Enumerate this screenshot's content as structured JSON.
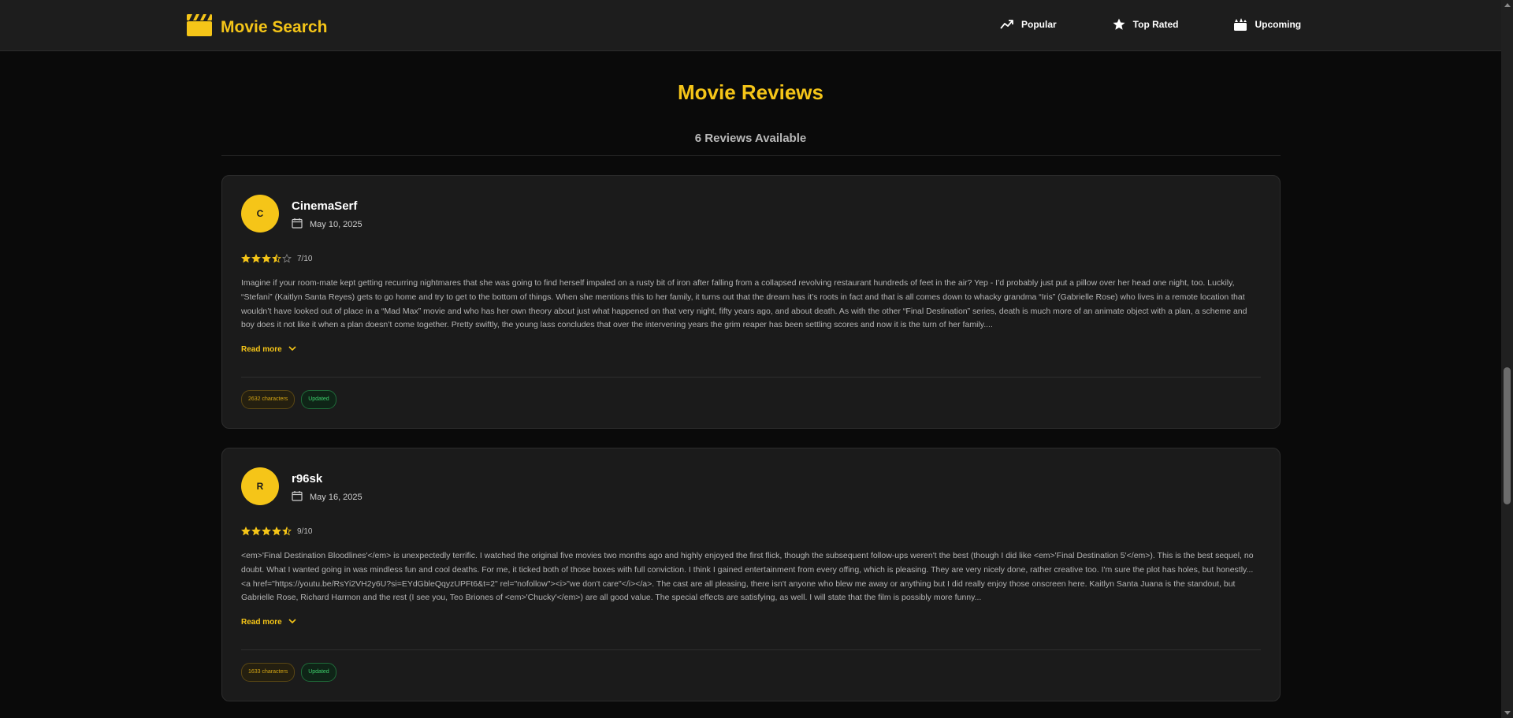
{
  "brand": {
    "title": "Movie Search",
    "icon": "clapperboard-icon",
    "color": "#f5c518"
  },
  "nav": {
    "popular": {
      "label": "Popular",
      "icon": "trending-up-icon"
    },
    "top_rated": {
      "label": "Top Rated",
      "icon": "star-icon"
    },
    "upcoming": {
      "label": "Upcoming",
      "icon": "calendar-event-icon"
    }
  },
  "page": {
    "title": "Movie Reviews",
    "count_label": "6 Reviews Available"
  },
  "reviews": [
    {
      "initial": "C",
      "author": "CinemaSerf",
      "date": "May 10, 2025",
      "rating": 7,
      "rating_label": "7/10",
      "content": "Imagine if your room-mate kept getting recurring nightmares that she was going to find herself impaled on a rusty bit of iron after falling from a collapsed revolving restaurant hundreds of feet in the air? Yep - I’d probably just put a pillow over her head one night, too. Luckily, “Stefani” (Kaitlyn Santa Reyes) gets to go home and try to get to the bottom of things. When she mentions this to her family, it turns out that the dream has it’s roots in fact and that is all comes down to whacky grandma “Iris” (Gabrielle Rose) who lives in a remote location that wouldn’t have looked out of place in a “Mad Max” movie and who has her own theory about just what happened on that very night, fifty years ago, and about death. As with the other “Final Destination” series, death is much more of an animate object with a plan, a scheme and boy does it not like it when a plan doesn’t come together. Pretty swiftly, the young lass concludes that over the intervening years the grim reaper has been settling scores and now it is the turn of her family....",
      "read_more": "Read more",
      "chars_tag": "2632 characters",
      "updated_tag": "Updated"
    },
    {
      "initial": "R",
      "author": "r96sk",
      "date": "May 16, 2025",
      "rating": 9,
      "rating_label": "9/10",
      "content": "<em>'Final Destination Bloodlines'</em> is unexpectedly terrific. I watched the original five movies two months ago and highly enjoyed the first flick, though the subsequent follow-ups weren't the best (though I did like <em>'Final Destination 5'</em>). This is the best sequel, no doubt. What I wanted going in was mindless fun and cool deaths. For me, it ticked both of those boxes with full conviction. I think I gained entertainment from every offing, which is pleasing. They are very nicely done, rather creative too. I'm sure the plot has holes, but honestly... <a href=\"https://youtu.be/RsYi2VH2y6U?si=EYdGbleQqyzUPFt6&t=2\" rel=\"nofollow\"><i>\"we don't care\"</i></a>. The cast are all pleasing, there isn't anyone who blew me away or anything but I did really enjoy those onscreen here. Kaitlyn Santa Juana is the standout, but Gabrielle Rose, Richard Harmon and the rest (I see you, Teo Briones of <em>'Chucky'</em>) are all good value. The special effects are satisfying, as well. I will state that the film is possibly more funny...",
      "read_more": "Read more",
      "chars_tag": "1633 characters",
      "updated_tag": "Updated"
    }
  ],
  "colors": {
    "accent": "#f5c518",
    "background": "#0a0a0a",
    "card": "#1b1b1b",
    "updated": "#3ccf6b"
  }
}
